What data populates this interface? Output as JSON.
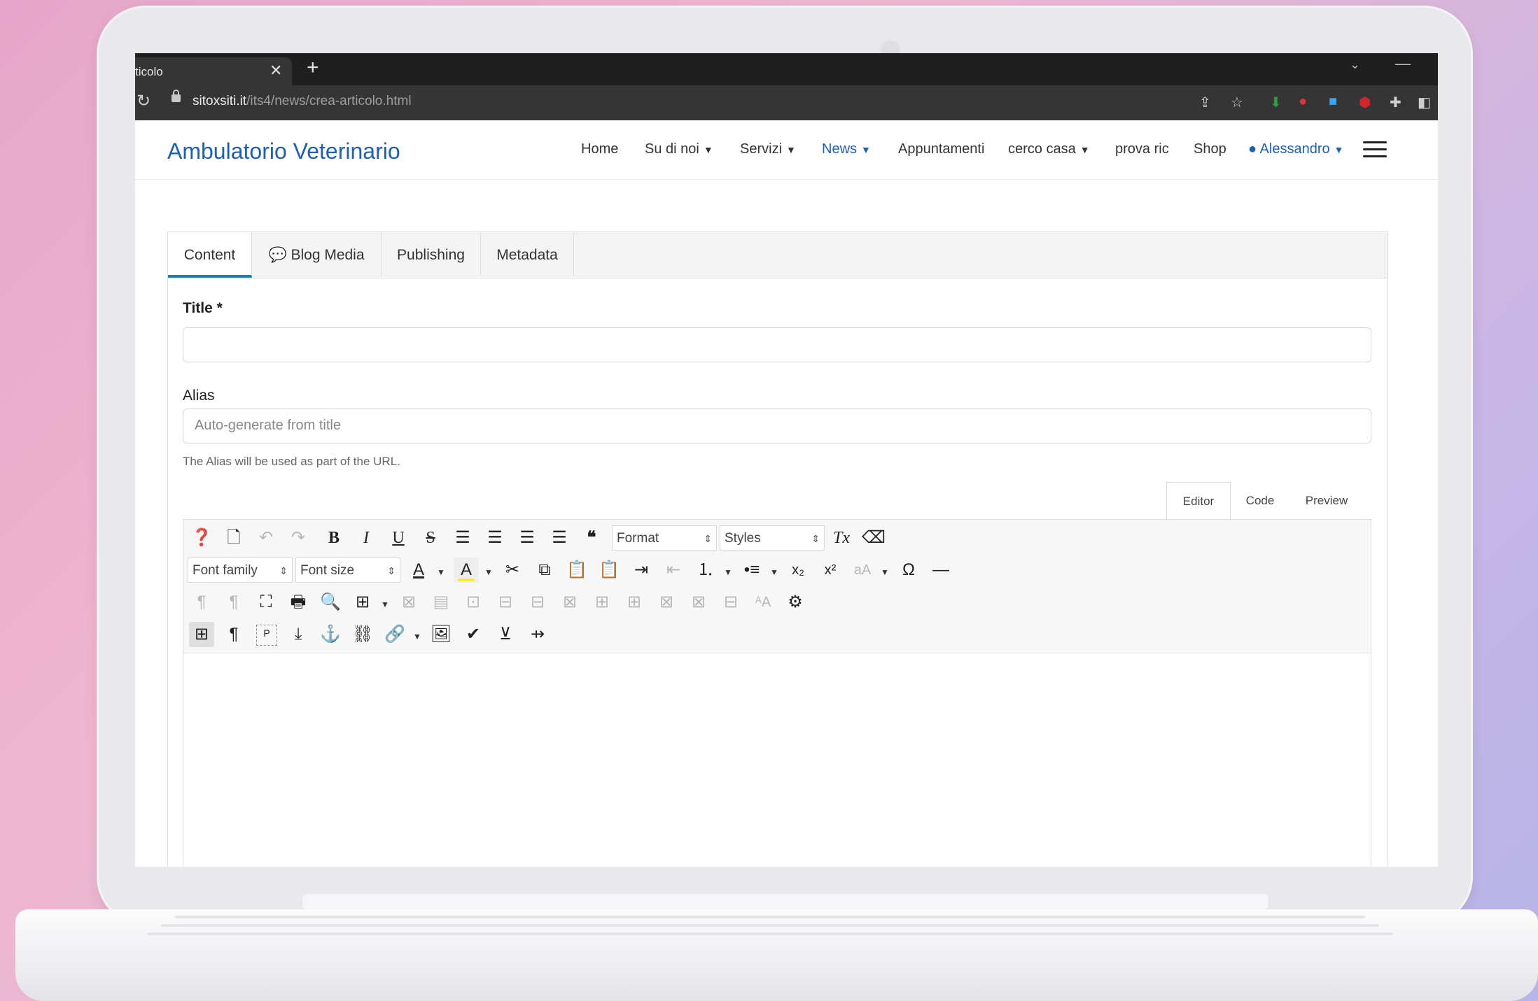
{
  "browser": {
    "tab_title": "ticolo",
    "tab_close": "✕",
    "new_tab": "+",
    "url_host": "sitoxsiti.it",
    "url_path": "/its4/news/crea-articolo.html"
  },
  "site": {
    "brand": "Ambulatorio Veterinario",
    "nav": [
      {
        "label": "Home"
      },
      {
        "label": "Su di noi"
      },
      {
        "label": "Servizi"
      },
      {
        "label": "News"
      },
      {
        "label": "Appuntamenti"
      },
      {
        "label": "cerco casa"
      },
      {
        "label": "prova ric"
      },
      {
        "label": "Shop"
      },
      {
        "label": "Alessandro"
      }
    ],
    "accent_color": "#1d5fb8"
  },
  "form": {
    "tabs": [
      "Content",
      "Blog Media",
      "Publishing",
      "Metadata"
    ],
    "title_label": "Title *",
    "title_value": "",
    "alias_label": "Alias",
    "alias_placeholder": "Auto-generate from title",
    "alias_help": "The Alias will be used as part of the URL.",
    "editor_tabs": [
      "Editor",
      "Code",
      "Preview"
    ],
    "format_select": "Format",
    "styles_select": "Styles",
    "font_family_select": "Font family",
    "font_size_select": "Font size"
  }
}
